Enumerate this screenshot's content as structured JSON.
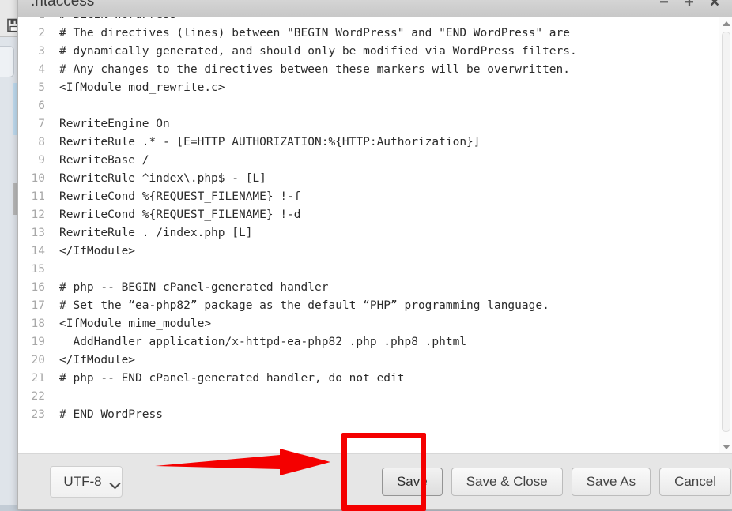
{
  "window": {
    "title": ".htaccess",
    "controls": [
      {
        "name": "minimize",
        "glyph": "minimize-icon"
      },
      {
        "name": "maximize",
        "glyph": "maximize-icon"
      },
      {
        "name": "close",
        "glyph": "close-icon"
      }
    ]
  },
  "background": {
    "save_icon_name": "floppy-disk-icon"
  },
  "editor": {
    "first_line_partial": "# BEGIN WordPress",
    "lines": [
      {
        "num": "2",
        "text": "# The directives (lines) between \"BEGIN WordPress\" and \"END WordPress\" are"
      },
      {
        "num": "3",
        "text": "# dynamically generated, and should only be modified via WordPress filters."
      },
      {
        "num": "4",
        "text": "# Any changes to the directives between these markers will be overwritten."
      },
      {
        "num": "5",
        "text": "<IfModule mod_rewrite.c>"
      },
      {
        "num": "6",
        "text": ""
      },
      {
        "num": "7",
        "text": "RewriteEngine On"
      },
      {
        "num": "8",
        "text": "RewriteRule .* - [E=HTTP_AUTHORIZATION:%{HTTP:Authorization}]"
      },
      {
        "num": "9",
        "text": "RewriteBase /"
      },
      {
        "num": "10",
        "text": "RewriteRule ^index\\.php$ - [L]"
      },
      {
        "num": "11",
        "text": "RewriteCond %{REQUEST_FILENAME} !-f"
      },
      {
        "num": "12",
        "text": "RewriteCond %{REQUEST_FILENAME} !-d"
      },
      {
        "num": "13",
        "text": "RewriteRule . /index.php [L]"
      },
      {
        "num": "14",
        "text": "</IfModule>"
      },
      {
        "num": "15",
        "text": ""
      },
      {
        "num": "16",
        "text": "# php -- BEGIN cPanel-generated handler"
      },
      {
        "num": "17",
        "text": "# Set the “ea-php82” package as the default “PHP” programming language."
      },
      {
        "num": "18",
        "text": "<IfModule mime_module>"
      },
      {
        "num": "19",
        "text": "  AddHandler application/x-httpd-ea-php82 .php .php8 .phtml"
      },
      {
        "num": "20",
        "text": "</IfModule>"
      },
      {
        "num": "21",
        "text": "# php -- END cPanel-generated handler, do not edit"
      },
      {
        "num": "22",
        "text": ""
      },
      {
        "num": "23",
        "text": "# END WordPress"
      }
    ],
    "scrollbar": {
      "up_arrow_name": "scroll-up-arrow",
      "down_arrow_name": "scroll-down-arrow"
    }
  },
  "footer": {
    "encoding": {
      "value": "UTF-8",
      "chevron_name": "chevron-down-icon"
    },
    "buttons": [
      {
        "label": "Save",
        "name": "save-button",
        "focused": true
      },
      {
        "label": "Save & Close",
        "name": "save-close-button",
        "focused": false
      },
      {
        "label": "Save As",
        "name": "save-as-button",
        "focused": false
      },
      {
        "label": "Cancel",
        "name": "cancel-button",
        "focused": false
      }
    ]
  },
  "annotations": {
    "highlight_color": "#f40000",
    "arrow_color": "#f40000",
    "highlight_target": "Save",
    "arrow_points_to": "Save"
  }
}
